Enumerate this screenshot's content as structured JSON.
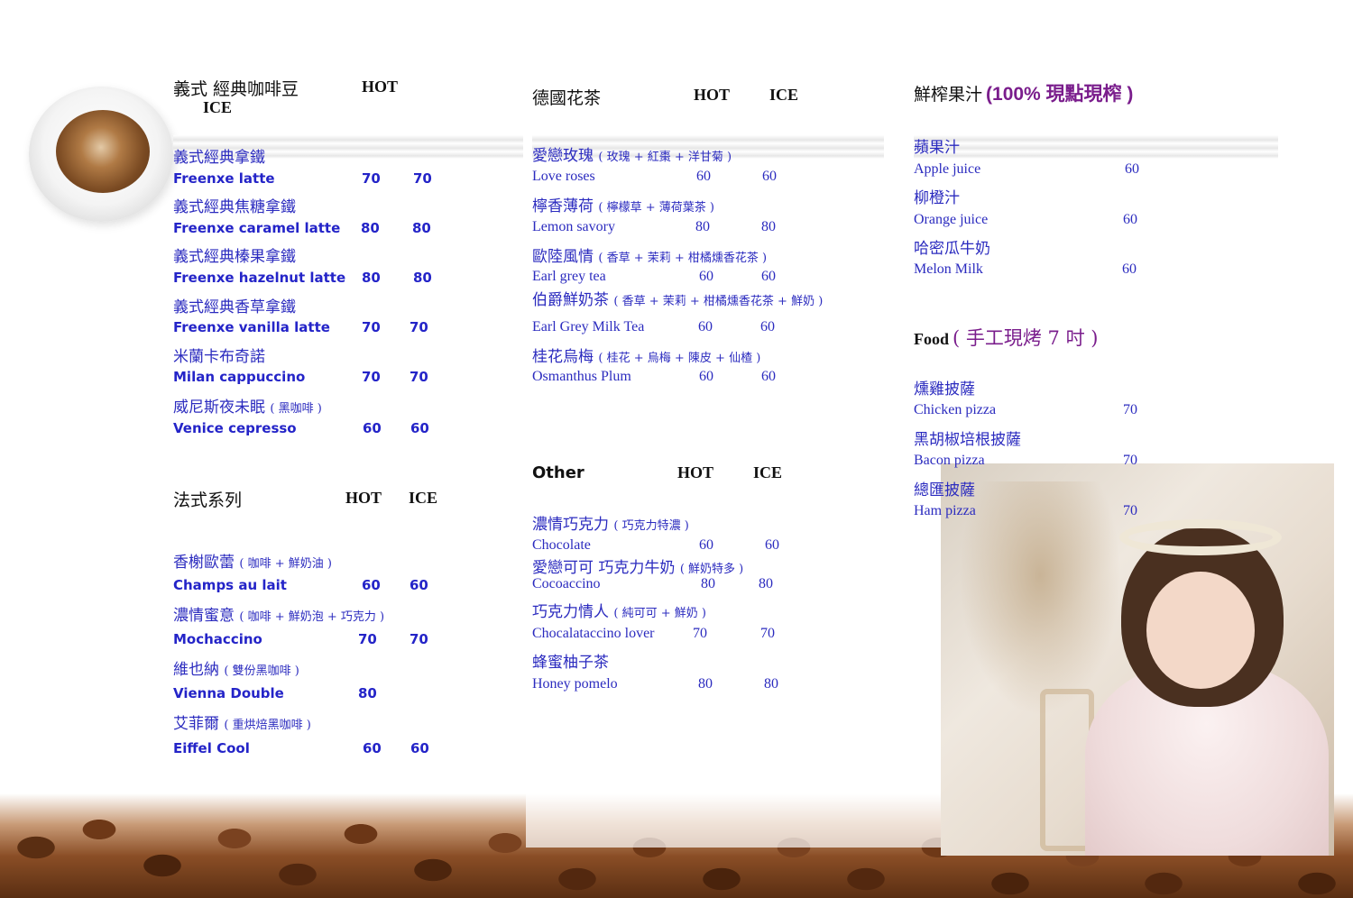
{
  "col1": {
    "section1": {
      "title": "義式 經典咖啡豆",
      "hot": "HOT",
      "ice": "ICE",
      "items": [
        {
          "zh": "義式經典拿鐵",
          "en": "Freenxe  latte",
          "hot": "70",
          "ice": "70"
        },
        {
          "zh": "義式經典焦糖拿鐵",
          "en": "Freenxe caramel latte",
          "hot": "80",
          "ice": "80"
        },
        {
          "zh": "義式經典榛果拿鐵",
          "en": "Freenxe hazelnut latte",
          "hot": "80",
          "ice": "80"
        },
        {
          "zh": "義式經典香草拿鐵",
          "en": "Freenxe vanilla latte",
          "hot": "70",
          "ice": "70"
        },
        {
          "zh": "米蘭卡布奇諾",
          "en": "Milan cappuccino",
          "hot": "70",
          "ice": "70"
        },
        {
          "zh": "威尼斯夜未眠",
          "note": "( 黑咖啡 )",
          "en": "Venice cepresso",
          "hot": "60",
          "ice": "60"
        }
      ]
    },
    "section2": {
      "title": "法式系列",
      "hot": "HOT",
      "ice": "ICE",
      "items": [
        {
          "zh": "香榭歐蕾",
          "note": "( 咖啡 + 鮮奶油 )",
          "en": "Champs au lait",
          "hot": "60",
          "ice": "60"
        },
        {
          "zh": "濃情蜜意",
          "note": "( 咖啡 + 鮮奶泡 + 巧克力 )",
          "en": "Mochaccino",
          "hot": "70",
          "ice": "70"
        },
        {
          "zh": "維也納",
          "note": "( 雙份黑咖啡 )",
          "en": "Vienna  Double",
          "hot": "80",
          "ice": ""
        },
        {
          "zh": "艾菲爾",
          "note": "( 重烘焙黑咖啡 )",
          "en": "Eiffel  Cool",
          "hot": "60",
          "ice": "60"
        }
      ]
    }
  },
  "col2": {
    "section1": {
      "title": "德國花茶",
      "hot": "HOT",
      "ice": "ICE",
      "items": [
        {
          "zh": "愛戀玫瑰",
          "note": "( 玫瑰 + 紅棗 + 洋甘菊 )",
          "en": "Love roses",
          "hot": "60",
          "ice": "60"
        },
        {
          "zh": "檸香薄荷",
          "note": "( 檸檬草 + 薄荷葉茶 )",
          "en": "Lemon savory",
          "hot": "80",
          "ice": "80"
        },
        {
          "zh": "歐陸風情",
          "note": "( 香草 + 茉莉 + 柑橘燻香花茶 )",
          "en": "Earl grey tea",
          "hot": "60",
          "ice": "60"
        },
        {
          "zh": "伯爵鮮奶茶",
          "note": "( 香草 + 茉莉 + 柑橘燻香花茶 + 鮮奶 )",
          "en": "Earl Grey Milk Tea",
          "hot": "60",
          "ice": "60"
        },
        {
          "zh": "桂花烏梅",
          "note": "( 桂花 + 烏梅 + 陳皮 + 仙楂 )",
          "en": "Osmanthus Plum",
          "hot": "60",
          "ice": "60"
        }
      ]
    },
    "section2": {
      "title": "Other",
      "hot": "HOT",
      "ice": "ICE",
      "items": [
        {
          "zh": "濃情巧克力",
          "note": "( 巧克力特濃 )",
          "en": "Chocolate",
          "hot": "60",
          "ice": "60"
        },
        {
          "zh": "愛戀可可 巧克力牛奶",
          "note": "( 鮮奶特多 )",
          "en": "Cocoaccino",
          "hot": "80",
          "ice": "80"
        },
        {
          "zh": "巧克力情人",
          "note": "( 純可可 + 鮮奶 )",
          "en": "Chocalataccino lover",
          "hot": "70",
          "ice": "70"
        },
        {
          "zh": "蜂蜜柚子茶",
          "note": "",
          "en": "Honey pomelo",
          "hot": "80",
          "ice": "80"
        }
      ]
    }
  },
  "col3": {
    "section1": {
      "title": "鮮榨果汁",
      "title_suffix": "(100% 現點現榨 )",
      "items": [
        {
          "zh": "蘋果汁",
          "en": "Apple juice",
          "price": "60"
        },
        {
          "zh": "柳橙汁",
          "en": "Orange juice",
          "price": "60"
        },
        {
          "zh": "哈密瓜牛奶",
          "en": "Melon Milk",
          "price": "60"
        }
      ]
    },
    "section2": {
      "title": "Food",
      "title_suffix": "( 手工現烤 7 吋 )",
      "items": [
        {
          "zh": "燻雞披薩",
          "en": "Chicken pizza",
          "price": "70"
        },
        {
          "zh": "黑胡椒培根披薩",
          "en": "Bacon pizza",
          "price": "70"
        },
        {
          "zh": "總匯披薩",
          "en": "Ham pizza",
          "price": "70"
        }
      ]
    }
  }
}
